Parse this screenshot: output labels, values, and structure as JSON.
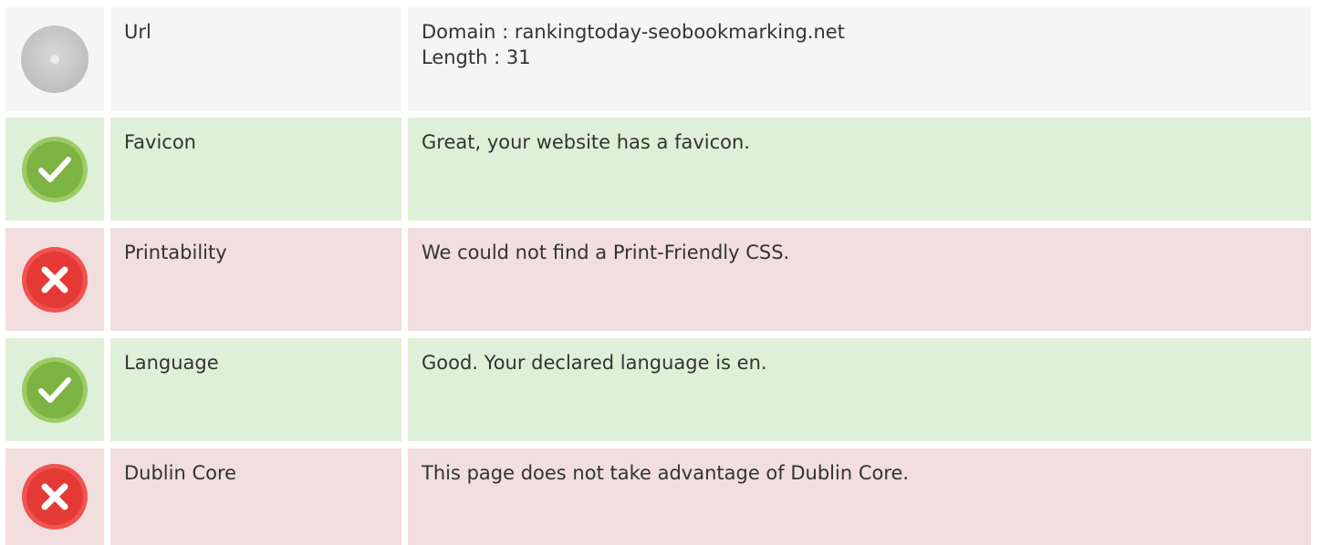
{
  "rows": [
    {
      "status": "neutral",
      "icon": "circle-icon",
      "label": "Url",
      "lines": [
        "Domain : rankingtoday-seobookmarking.net",
        "Length : 31"
      ]
    },
    {
      "status": "success",
      "icon": "checkmark-icon",
      "label": "Favicon",
      "lines": [
        "Great, your website has a favicon."
      ]
    },
    {
      "status": "fail",
      "icon": "cross-icon",
      "label": "Printability",
      "lines": [
        "We could not find a Print-Friendly CSS."
      ]
    },
    {
      "status": "success",
      "icon": "checkmark-icon",
      "label": "Language",
      "lines": [
        "Good. Your declared language is en."
      ]
    },
    {
      "status": "fail",
      "icon": "cross-icon",
      "label": "Dublin Core",
      "lines": [
        "This page does not take advantage of Dublin Core."
      ]
    }
  ],
  "colors": {
    "neutral_bg": "#f5f5f5",
    "success_bg": "#dff0d8",
    "fail_bg": "#f2dede",
    "success_icon": "#8bc34a",
    "fail_icon": "#e53935"
  }
}
